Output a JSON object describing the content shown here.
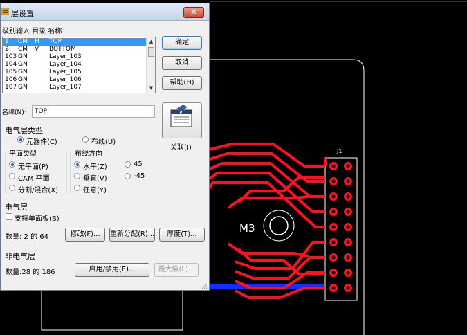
{
  "dialog": {
    "title": "层设置",
    "close_label": "✕",
    "list_header": "级别输入  目录  名称",
    "layers": [
      {
        "level": "1",
        "type": "CM",
        "dir": "H",
        "name": "TOP",
        "selected": true
      },
      {
        "level": "2",
        "type": "CM",
        "dir": "V",
        "name": "BOTTOM",
        "selected": false
      },
      {
        "level": "103",
        "type": "GN",
        "dir": "",
        "name": "Layer_103",
        "selected": false
      },
      {
        "level": "104",
        "type": "GN",
        "dir": "",
        "name": "Layer_104",
        "selected": false
      },
      {
        "level": "105",
        "type": "GN",
        "dir": "",
        "name": "Layer_105",
        "selected": false
      },
      {
        "level": "106",
        "type": "GN",
        "dir": "",
        "name": "Layer_106",
        "selected": false
      },
      {
        "level": "107",
        "type": "GN",
        "dir": "",
        "name": "Layer_107",
        "selected": false
      }
    ],
    "ok_label": "确定",
    "cancel_label": "取消",
    "help_label": "帮助(H)",
    "assoc_label": "关联(I)",
    "name_label": "名称(N):",
    "name_value": "TOP",
    "elec_type_title": "电气层类型",
    "component_label": "元器件(C)",
    "routing_label": "布线(U)",
    "plane_type_title": "平面类型",
    "no_plane_label": "无平面(P)",
    "cam_plane_label": "CAM 平面",
    "split_mixed_label": "分割/混合(X)",
    "route_dir_title": "布线方向",
    "horizontal_label": "水平(Z)",
    "vertical_label": "垂直(V)",
    "any_label": "任意(Y)",
    "deg45_label": "45",
    "degm45_label": "-45",
    "elec_layer_title": "电气层",
    "single_side_label": "支持单面板(B)",
    "elec_count": "数量: 2 的 64",
    "modify_label": "修改(F)...",
    "reassign_label": "重新分配(R)...",
    "thickness_label": "厚度(T)...",
    "nonelec_title": "非电气层",
    "nonelec_count": "数量:28 的 186",
    "enable_disable_label": "启用/禁用(E)...",
    "max_layer_label": "最大层(L)..."
  },
  "pcb": {
    "component_ref": "M3",
    "connector_ref": "J1"
  },
  "colors": {
    "trace": "#ff1020",
    "bottom_trace": "#1030ff",
    "outline": "#ffffff",
    "background": "#000000",
    "selection": "#3399ff"
  }
}
